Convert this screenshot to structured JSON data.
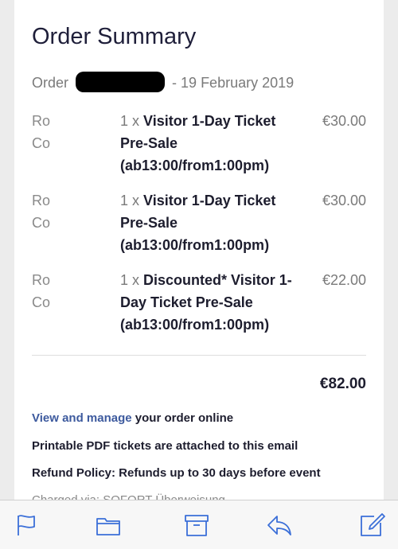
{
  "summary": {
    "title": "Order Summary",
    "order_label": "Order",
    "order_date": "- 19 February 2019"
  },
  "items": [
    {
      "who_1": "Ro",
      "who_2": "Co",
      "qty": "1 x ",
      "name": "Visitor 1-Day Ticket Pre-Sale (ab13:00/from1:00pm)",
      "price": "€30.00"
    },
    {
      "who_1": "Ro",
      "who_2": "Co",
      "qty": "1 x ",
      "name": "Visitor 1-Day Ticket Pre-Sale (ab13:00/from1:00pm)",
      "price": "€30.00"
    },
    {
      "who_1": "Ro",
      "who_2": "Co",
      "qty": "1 x ",
      "name": "Discounted* Visitor 1-Day Ticket Pre-Sale (ab13:00/from1:00pm)",
      "price": "€22.00"
    }
  ],
  "total": "€82.00",
  "info": {
    "manage_link": "View and manage",
    "manage_rest": " your order online",
    "pdf_note": "Printable PDF tickets are attached to this email",
    "refund_policy": "Refund Policy: Refunds up to 30 days before event",
    "charged": "Charged via: SOFORT Überweisung"
  },
  "toolbar": {
    "icons": [
      "flag-icon",
      "folder-icon",
      "archive-icon",
      "reply-icon",
      "compose-icon"
    ]
  },
  "colors": {
    "link": "#3d5a9e",
    "text": "#1d1d2e",
    "muted": "#7a7a7a",
    "icon": "#3b6fd8"
  }
}
